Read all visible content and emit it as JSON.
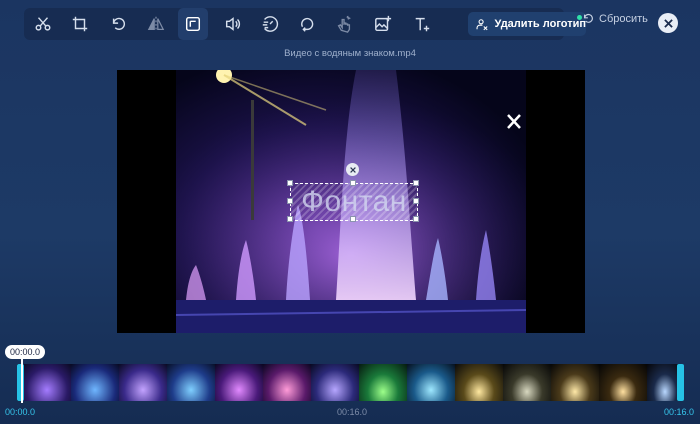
{
  "toolbar": {
    "tools": [
      {
        "name": "cut",
        "icon": "scissors-icon"
      },
      {
        "name": "crop",
        "icon": "crop-icon"
      },
      {
        "name": "rotate",
        "icon": "rotate-icon"
      },
      {
        "name": "flip",
        "icon": "flip-icon"
      },
      {
        "name": "remove-logo",
        "icon": "watermark-select-icon",
        "active": true
      },
      {
        "name": "volume",
        "icon": "volume-icon"
      },
      {
        "name": "speed",
        "icon": "speed-icon"
      },
      {
        "name": "loop",
        "icon": "loop-icon"
      },
      {
        "name": "stabilize",
        "icon": "hand-icon"
      },
      {
        "name": "add-image",
        "icon": "add-image-icon"
      },
      {
        "name": "add-text",
        "icon": "add-text-icon"
      }
    ],
    "remove_logo_label": "Удалить логотип",
    "reset_label": "Сбросить"
  },
  "file": {
    "name": "Видео с водяным знаком.mp4"
  },
  "logo_text": "Фонтан",
  "timeline": {
    "current_time": "00:00.0",
    "start_label": "00:00.0",
    "mid_label": "00:16.0",
    "end_label": "00:16.0"
  },
  "colors": {
    "accent": "#26c2e6",
    "background": "#1d3a66",
    "badge": "#2fe0a8"
  }
}
